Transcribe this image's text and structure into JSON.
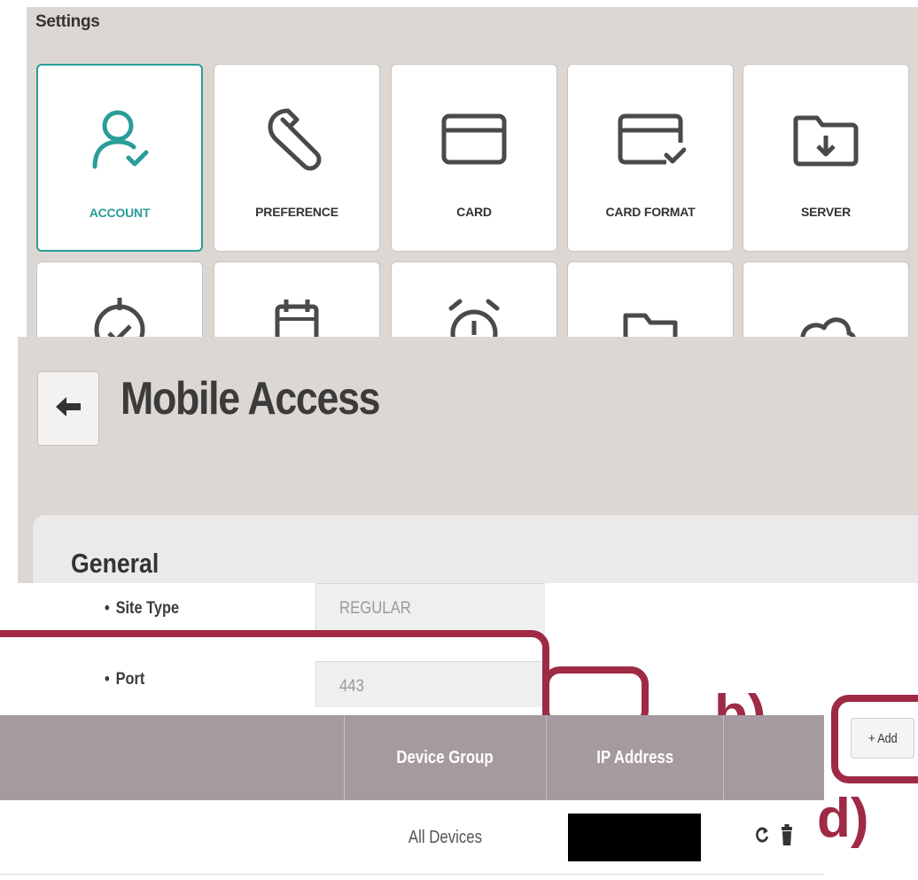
{
  "settings": {
    "title": "Settings",
    "tiles": [
      {
        "label": "ACCOUNT",
        "icon": "user-check-icon",
        "active": true
      },
      {
        "label": "PREFERENCE",
        "icon": "wrench-icon",
        "active": false
      },
      {
        "label": "CARD",
        "icon": "card-icon",
        "active": false
      },
      {
        "label": "CARD FORMAT",
        "icon": "card-check-icon",
        "active": false
      },
      {
        "label": "SERVER",
        "icon": "folder-download-icon",
        "active": false
      }
    ],
    "second_row_icons": [
      "target-check-icon",
      "calendar-icon",
      "alarm-clock-icon",
      "folder-check-icon",
      "cloud-icon"
    ]
  },
  "mobile_access": {
    "title": "Mobile Access",
    "back_icon": "arrow-left-icon",
    "section_title": "General"
  },
  "form": {
    "site_type_label": "Site Type",
    "site_type_value": "REGULAR",
    "port_label": "Port",
    "port_value": "443",
    "bullet": "•"
  },
  "table": {
    "columns": [
      "",
      "Device Group",
      "IP Address",
      ""
    ],
    "rows": [
      {
        "device_group": "All Devices",
        "ip_address_redacted": true,
        "actions": [
          "refresh-icon",
          "trash-icon"
        ]
      }
    ],
    "add_label": "+ Add"
  },
  "annotations": {
    "b_label": "b)",
    "d_label": "d)"
  },
  "colors": {
    "accent": "#2a9d98",
    "panel_bg": "#dcd7d2",
    "table_header": "#a59a9f",
    "annotation": "#9e2a45"
  }
}
